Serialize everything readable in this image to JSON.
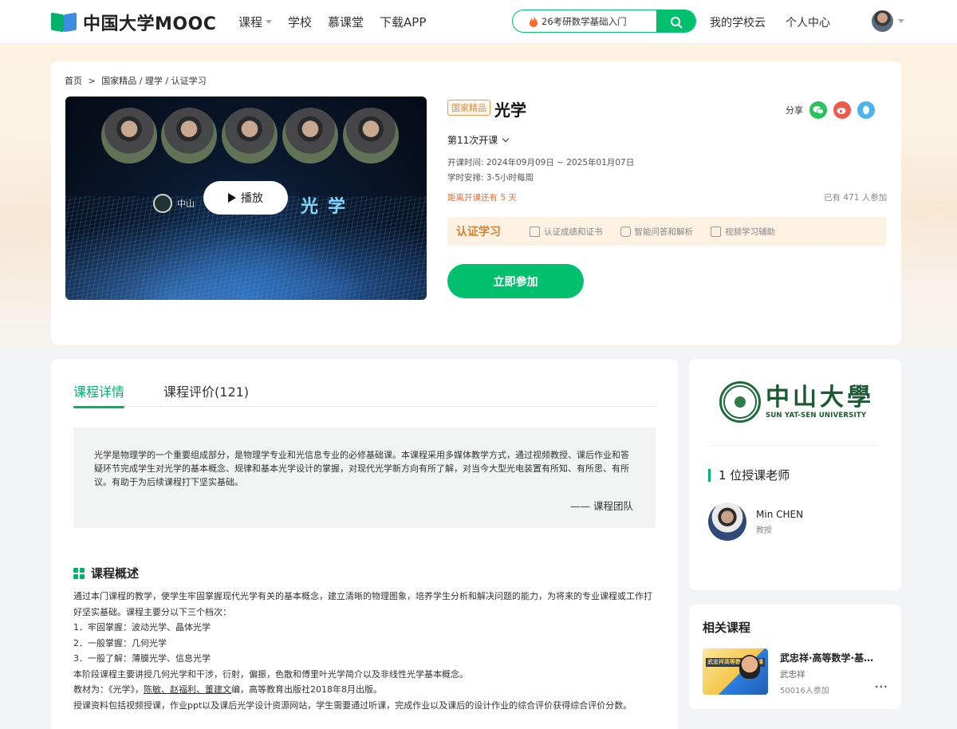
{
  "header": {
    "logo_text": "中国大学MOOC",
    "nav": [
      "课程",
      "学校",
      "慕课堂",
      "下载APP"
    ],
    "search_placeholder": "26考研数学基础入门",
    "links": [
      "我的学校云",
      "个人中心"
    ]
  },
  "course": {
    "breadcrumb": [
      "首页",
      ">",
      "国家精品 / 理学 / 认证学习"
    ],
    "tag": "国家精品",
    "title": "光学",
    "share_label": "分享",
    "session": "第11次开课",
    "open_time": "开课时间:  2024年09月09日 ~ 2025年01月07日",
    "schedule": "学时安排:  3-5小时每周",
    "countdown": "距离开课还有 5 天",
    "joined": "已有 471 人参加",
    "cert_title": "认证学习",
    "cert_items": [
      "认证成绩和证书",
      "智能问答和解析",
      "视频学习辅助"
    ],
    "join_label": "立即参加",
    "video": {
      "play_label": "播放",
      "logo_text": "中山",
      "title_text": "光学"
    }
  },
  "detail": {
    "tabs": [
      "课程详情",
      "课程评价(121)"
    ],
    "intro": "光学是物理学的一个重要组成部分，是物理学专业和光信息专业的必修基础课。本课程采用多媒体教学方式，通过视频教授、课后作业和答疑环节完成学生对光学的基本概念、规律和基本光学设计的掌握，对现代光学新方向有所了解，对当今大型光电装置有所知、有所思、有所议。有助于为后续课程打下坚实基础。",
    "intro_sign": "—— 课程团队",
    "overview_title": "课程概述",
    "overview": {
      "p1": "通过本门课程的教学，使学生牢固掌握现代光学有关的基本概念，建立清晰的物理图象，培养学生分析和解决问题的能力，为将来的专业课程或工作打好坚实基础。课程主要分以下三个档次：",
      "l1": "1．牢固掌握：波动光学、晶体光学",
      "l2": "2．一般掌握：几何光学",
      "l3": "3．一般了解：薄膜光学、信息光学",
      "p2": "本阶段课程主要讲授几何光学和干涉，衍射，偏振，色散和傅里叶光学简介以及非线性光学基本概念。",
      "book_prefix": "教材为：《光学》，",
      "book_authors": "陈敏、赵福利、董建文",
      "book_suffix": "编，高等教育出版社2018年8月出版。",
      "p3": "授课资料包括视频授课，作业ppt以及课后光学设计资源网站，学生需要通过听课，完成作业以及课后的设计作业的综合评价获得综合评价分数。"
    }
  },
  "sidebar": {
    "university_cn": "中山大學",
    "university_en": "SUN YAT-SEN UNIVERSITY",
    "teacher_count": "1 位授课老师",
    "teacher_name": "Min CHEN",
    "teacher_title": "教授",
    "related_title": "相关课程",
    "related_course": {
      "title": "武忠祥·高等数学·基础篇",
      "author": "武忠祥",
      "count": "50016人参加",
      "thumb_text": "武忠祥高等数学基础课"
    }
  },
  "colors": {
    "brand_green": "#00c06e",
    "accent_orange": "#f26b3a",
    "cert_gold": "#d1832a"
  }
}
